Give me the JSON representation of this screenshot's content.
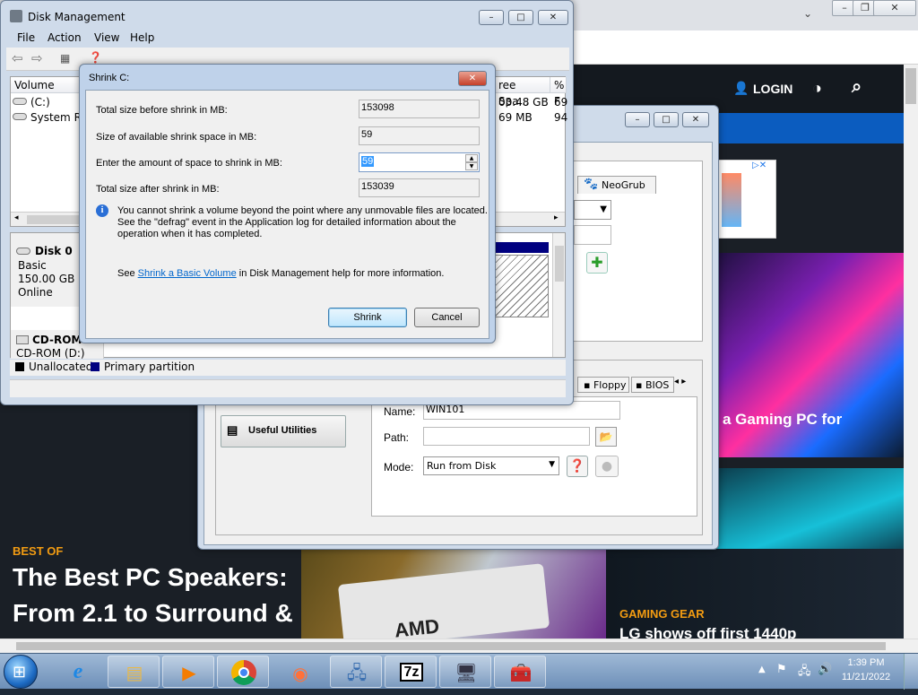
{
  "browser": {
    "login_label": "LOGIN",
    "article1": {
      "label": "BEST OF",
      "title_line1": "The Best PC Speakers:",
      "title_line2": "From 2.1 to Surround &"
    },
    "article2": {
      "label": "GAMING GEAR",
      "title": "LG shows off first 1440p"
    },
    "article3_title": "a Gaming PC for",
    "amd_logo_text": "AMD"
  },
  "easybcd": {
    "tab_neogrub": "NeoGrub",
    "tab_floppy": "Floppy",
    "tab_bios": "BIOS",
    "useful_utilities": "Useful Utilities",
    "name_label": "Name:",
    "name_value": "WIN101",
    "path_label": "Path:",
    "path_value": "",
    "mode_label": "Mode:",
    "mode_value": "Run from Disk"
  },
  "disk_management": {
    "title": "Disk Management",
    "menus": [
      "File",
      "Action",
      "View",
      "Help"
    ],
    "columns": {
      "volume": "Volume",
      "free_space": "ree Spa...",
      "pct": "% F"
    },
    "volumes": [
      {
        "name": "(C:)",
        "free": "03.48 GB",
        "pct": "69"
      },
      {
        "name": "System Res",
        "free": "69 MB",
        "pct": "94"
      }
    ],
    "disk0": {
      "name": "Disk 0",
      "type": "Basic",
      "size": "150.00 GB",
      "status": "Online"
    },
    "cdrom": {
      "name": "CD-ROM",
      "label": "CD-ROM (D:)"
    },
    "legend": {
      "unallocated": "Unallocated",
      "primary": "Primary partition"
    },
    "colors": {
      "unallocated": "#000000",
      "primary": "#000080"
    }
  },
  "shrink_dialog": {
    "title": "Shrink C:",
    "total_before_label": "Total size before shrink in MB:",
    "total_before_value": "153098",
    "available_label": "Size of available shrink space in MB:",
    "available_value": "59",
    "amount_label": "Enter the amount of space to shrink in MB:",
    "amount_value": "59",
    "total_after_label": "Total size after shrink in MB:",
    "total_after_value": "153039",
    "info_line1": "You cannot shrink a volume beyond the point where any unmovable files are located.",
    "info_line2": "See the \"defrag\" event in the Application log for detailed information about the",
    "info_line3": "operation when it has completed.",
    "see_prefix": "See",
    "see_link": "Shrink a Basic Volume",
    "see_suffix": "in Disk Management help for more information.",
    "shrink_button": "Shrink",
    "cancel_button": "Cancel"
  },
  "taskbar": {
    "time": "1:39 PM",
    "date": "11/21/2022",
    "items": [
      "internet-explorer",
      "file-explorer",
      "media-player",
      "chrome",
      "firefox",
      "network-tool",
      "7zip",
      "computer-management",
      "toolbox"
    ]
  }
}
